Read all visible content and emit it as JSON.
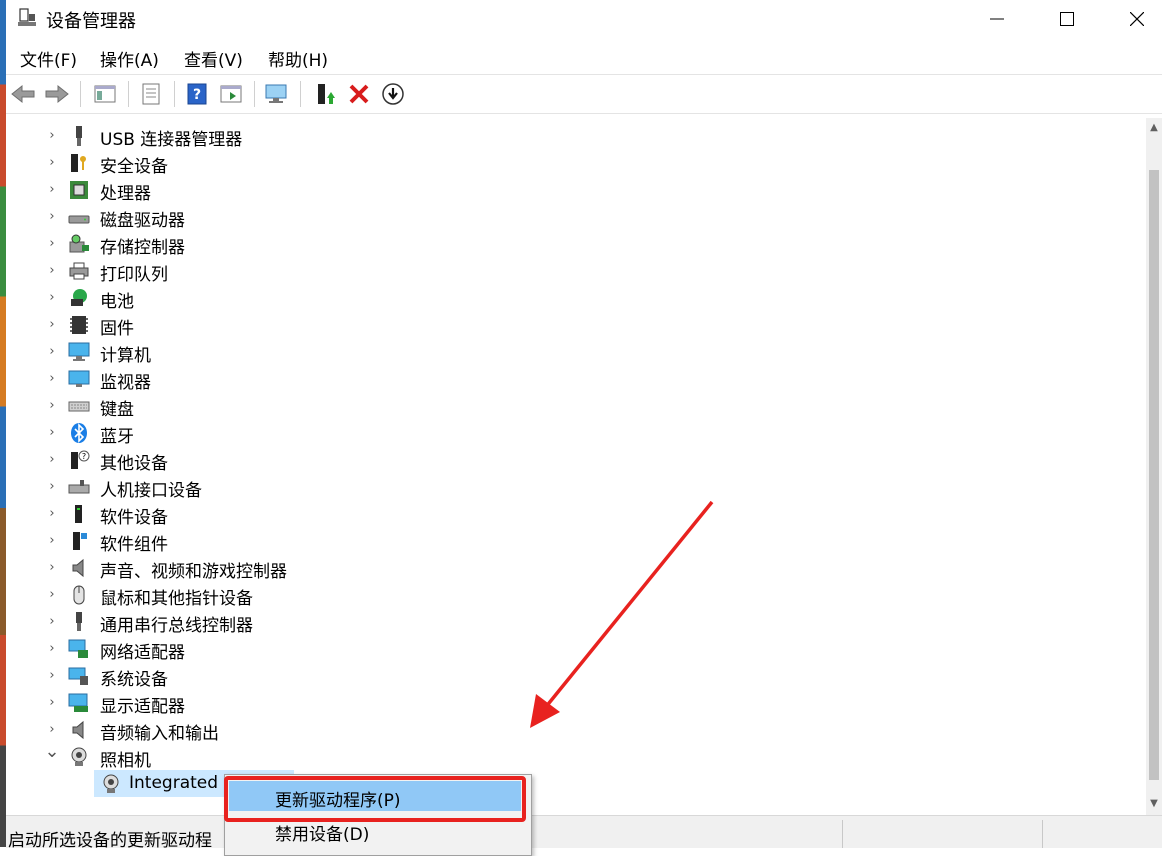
{
  "window": {
    "title": "设备管理器"
  },
  "menu": {
    "file": "文件(F)",
    "action": "操作(A)",
    "view": "查看(V)",
    "help": "帮助(H)"
  },
  "tree": {
    "items": [
      {
        "label": "USB 连接器管理器",
        "icon": "usb-connector-icon"
      },
      {
        "label": "安全设备",
        "icon": "security-device-icon"
      },
      {
        "label": "处理器",
        "icon": "processor-icon"
      },
      {
        "label": "磁盘驱动器",
        "icon": "disk-drive-icon"
      },
      {
        "label": "存储控制器",
        "icon": "storage-controller-icon"
      },
      {
        "label": "打印队列",
        "icon": "printer-icon"
      },
      {
        "label": "电池",
        "icon": "battery-icon"
      },
      {
        "label": "固件",
        "icon": "firmware-icon"
      },
      {
        "label": "计算机",
        "icon": "computer-icon"
      },
      {
        "label": "监视器",
        "icon": "monitor-icon"
      },
      {
        "label": "键盘",
        "icon": "keyboard-icon"
      },
      {
        "label": "蓝牙",
        "icon": "bluetooth-icon"
      },
      {
        "label": "其他设备",
        "icon": "other-device-icon"
      },
      {
        "label": "人机接口设备",
        "icon": "hid-icon"
      },
      {
        "label": "软件设备",
        "icon": "software-device-icon"
      },
      {
        "label": "软件组件",
        "icon": "software-component-icon"
      },
      {
        "label": "声音、视频和游戏控制器",
        "icon": "sound-icon"
      },
      {
        "label": "鼠标和其他指针设备",
        "icon": "mouse-icon"
      },
      {
        "label": "通用串行总线控制器",
        "icon": "usb-controller-icon"
      },
      {
        "label": "网络适配器",
        "icon": "network-adapter-icon"
      },
      {
        "label": "系统设备",
        "icon": "system-device-icon"
      },
      {
        "label": "显示适配器",
        "icon": "display-adapter-icon"
      },
      {
        "label": "音频输入和输出",
        "icon": "audio-io-icon"
      },
      {
        "label": "照相机",
        "icon": "camera-icon",
        "expanded": true
      }
    ],
    "camera_child": {
      "label": "Integrated C",
      "icon": "webcam-icon"
    }
  },
  "context_menu": {
    "update_driver": "更新驱动程序(P)",
    "disable_device": "禁用设备(D)"
  },
  "status": {
    "text": "启动所选设备的更新驱动程"
  },
  "colors": {
    "selection": "#cce8ff",
    "menu_highlight": "#90c8f6",
    "annotation": "#e8221f"
  }
}
